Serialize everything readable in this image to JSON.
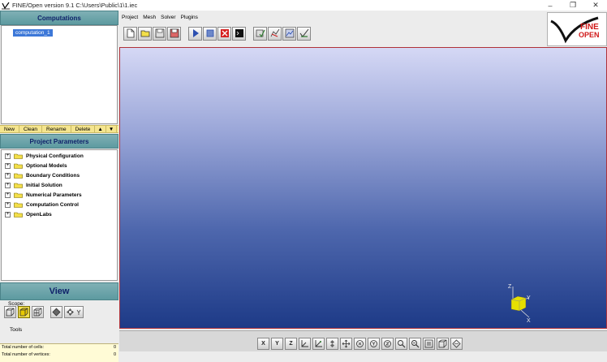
{
  "window": {
    "title": "FINE/Open version 9.1    C:\\Users\\Public\\1\\1.iec",
    "minimize_glyph": "–",
    "restore_glyph": "❐",
    "close_glyph": "✕"
  },
  "menu": [
    "Project",
    "Mesh",
    "Solver",
    "Plugins"
  ],
  "computations": {
    "header": "Computations",
    "items": [
      "computation_1"
    ],
    "buttons": [
      "New",
      "Clean",
      "Rename",
      "Delete"
    ],
    "up_arrow": "▲",
    "down_arrow": "▼"
  },
  "project_parameters": {
    "header": "Project Parameters",
    "items": [
      "Physical Configuration",
      "Optional Models",
      "Boundary Conditions",
      "Initial Solution",
      "Numerical Parameters",
      "Computation Control",
      "OpenLabs"
    ]
  },
  "view": {
    "header": "View",
    "scope_label": "Scope:",
    "tools_label": "Tools",
    "stats": [
      {
        "label": "Total number of cells:",
        "value": "0"
      },
      {
        "label": "Total number of vertices:",
        "value": "0"
      }
    ]
  },
  "logo": {
    "line1": "FINE",
    "line2": "OPEN"
  },
  "axes": {
    "z": "Z",
    "y": "Y",
    "x": "X"
  },
  "view_buttons": [
    "X",
    "Y",
    "Z"
  ],
  "colors": {
    "header": "#5d9aa0",
    "header_text": "#10226a",
    "selection": "#3d78d8",
    "button_bar": "#f5e58e",
    "viewport_top": "#d5d8f5",
    "viewport_bottom": "#1d3a87",
    "viewport_border": "#b0323a"
  }
}
